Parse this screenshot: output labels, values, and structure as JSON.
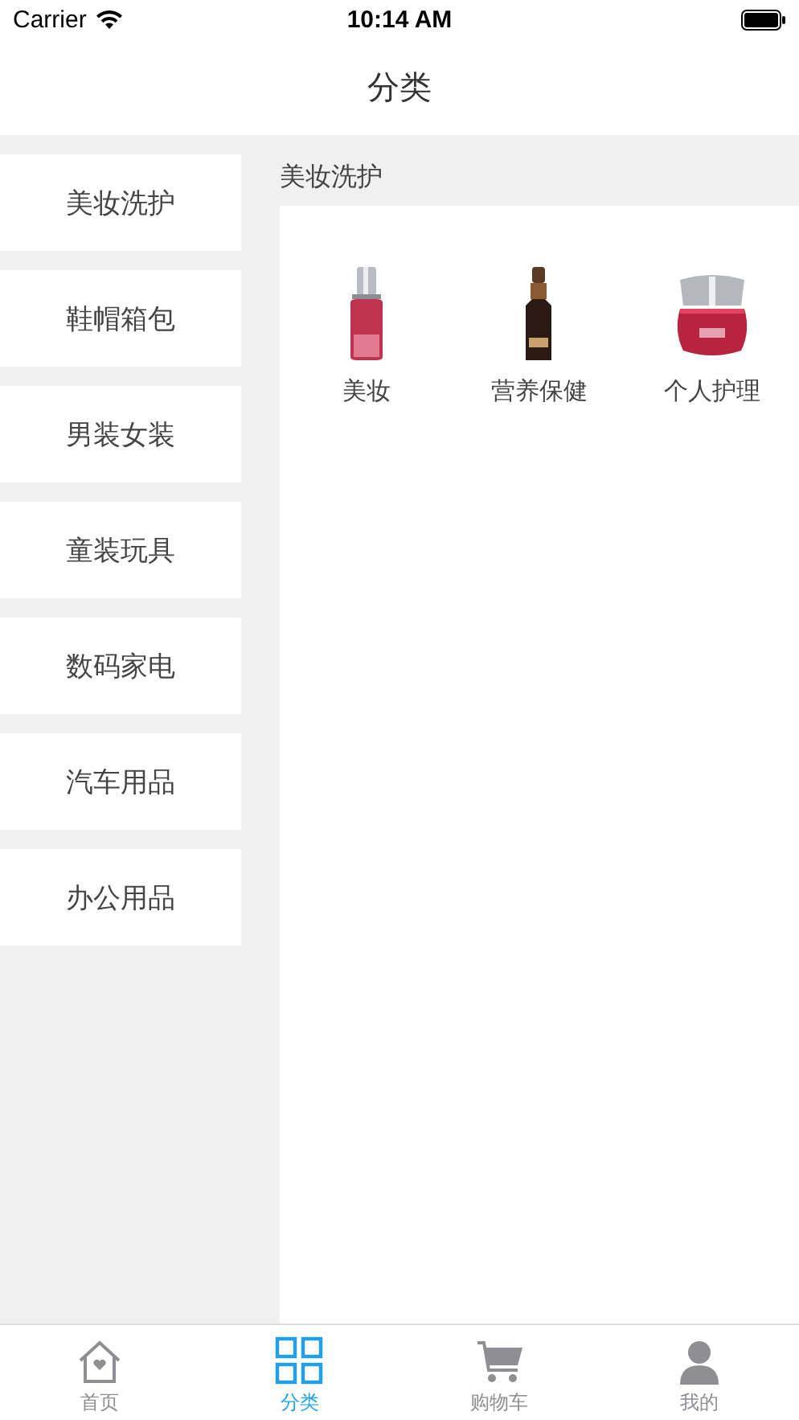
{
  "status_bar": {
    "carrier": "Carrier",
    "time": "10:14 AM"
  },
  "nav": {
    "title": "分类"
  },
  "categories": [
    {
      "label": "美妆洗护"
    },
    {
      "label": "鞋帽箱包"
    },
    {
      "label": "男装女装"
    },
    {
      "label": "童装玩具"
    },
    {
      "label": "数码家电"
    },
    {
      "label": "汽车用品"
    },
    {
      "label": "办公用品"
    }
  ],
  "section": {
    "title": "美妆洗护",
    "items": [
      {
        "label": "美妆",
        "kind": "picture"
      },
      {
        "label": "营养保健",
        "kind": "picture"
      },
      {
        "label": "个人护理",
        "kind": "picture"
      }
    ]
  },
  "tabs": [
    {
      "label": "首页",
      "kind": "home",
      "selected": false
    },
    {
      "label": "分类",
      "kind": "grid",
      "selected": true
    },
    {
      "label": "购物车",
      "kind": "cart",
      "selected": false
    },
    {
      "label": "我的",
      "kind": "person",
      "selected": false
    }
  ]
}
